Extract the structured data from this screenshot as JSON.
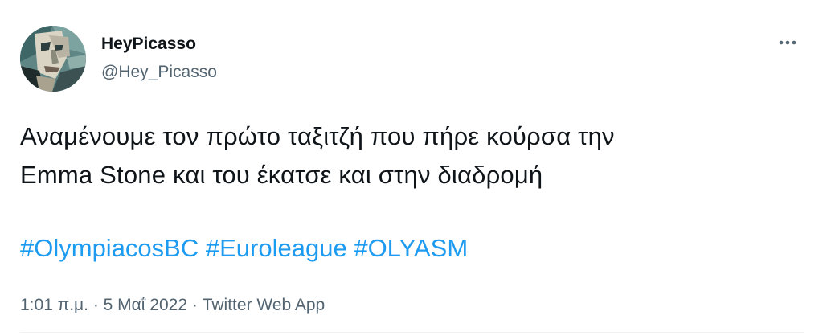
{
  "author": {
    "display_name": "HeyPicasso",
    "handle": "@Hey_Picasso",
    "avatar_icon": "picasso-portrait-avatar"
  },
  "menu": {
    "icon": "more-horizontal-icon"
  },
  "tweet": {
    "lines": [
      "Αναμένουμε τον πρώτο ταξιτζή που πήρε κούρσα την",
      "Emma Stone και του έκατσε και στην διαδρομή"
    ],
    "hashtags": [
      "#OlympiacosBC",
      "#Euroleague",
      "#OLYASM"
    ]
  },
  "meta": {
    "time": "1:01 π.μ.",
    "date": "5 Μαΐ 2022",
    "source": "Twitter Web App",
    "separator": "·"
  },
  "colors": {
    "text": "#0f1419",
    "secondary": "#536471",
    "link": "#1d9bf0"
  }
}
